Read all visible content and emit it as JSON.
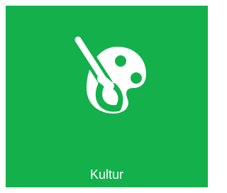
{
  "tile": {
    "label": "Kultur",
    "icon": "palette-brush-icon",
    "background_color": "#13b04b",
    "foreground_color": "#ffffff"
  }
}
